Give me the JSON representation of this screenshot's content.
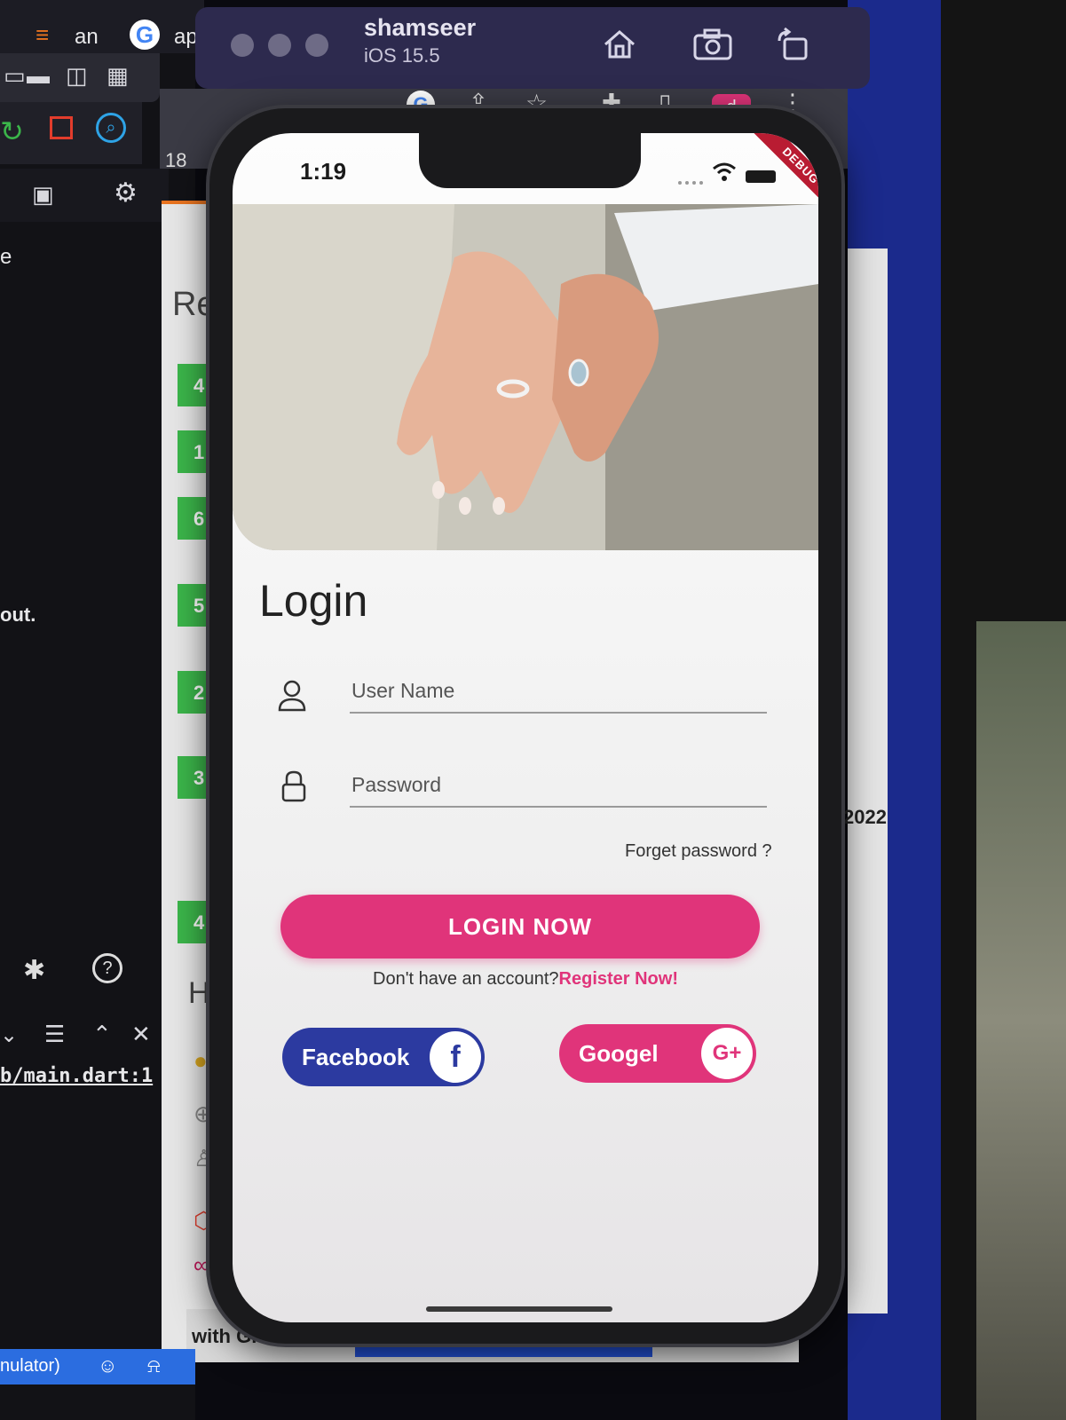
{
  "simulator": {
    "device_name": "shamseer",
    "os_version": "iOS 15.5",
    "toolbar_icons": [
      "home-icon",
      "screenshot-icon",
      "rotate-icon"
    ]
  },
  "status_bar": {
    "time": "1:19",
    "debug_banner": "DEBUG"
  },
  "login": {
    "title": "Login",
    "username_placeholder": "User Name",
    "password_placeholder": "Password",
    "forgot_password": "Forget password ?",
    "login_button": "LOGIN NOW",
    "no_account_text": "Don't have an account?",
    "register_link": "Register Now!",
    "facebook_button": "Facebook",
    "facebook_icon_text": "f",
    "google_button": "Googel",
    "google_icon_text": "G+"
  },
  "colors": {
    "accent": "#e0347a",
    "facebook": "#2c3aa0"
  },
  "background_ide": {
    "tabs": [
      "an",
      "ap"
    ],
    "visible_text_fragments": [
      "e",
      "out.",
      "b/main.dart:1",
      "nulator)",
      "Re",
      "Hc",
      "with Git",
      "2022"
    ],
    "step_numbers": [
      "4",
      "1",
      "6",
      "5",
      "2",
      "3",
      "4"
    ]
  }
}
